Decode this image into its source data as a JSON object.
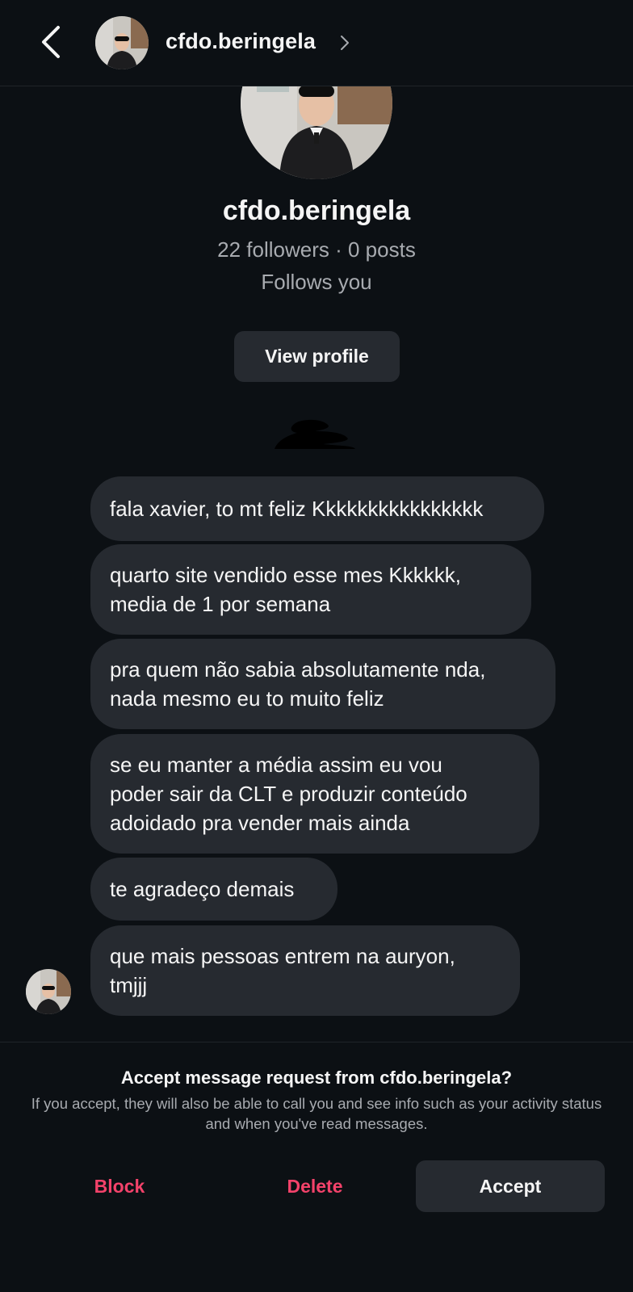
{
  "header": {
    "username": "cfdo.beringela"
  },
  "profile": {
    "username": "cfdo.beringela",
    "stats": "22 followers · 0 posts",
    "follows_status": "Follows you",
    "view_profile_label": "View profile"
  },
  "messages": [
    {
      "lines": [
        "fala xavier, to mt feliz Kkkkkkkkkkkkkkkk"
      ]
    },
    {
      "lines": [
        "quarto site vendido esse mes Kkkkkk,",
        "media de 1 por semana"
      ]
    },
    {
      "lines": [
        "pra quem não sabia absolutamente nda,",
        "nada mesmo eu to muito feliz"
      ]
    },
    {
      "lines": [
        "se eu manter a média assim eu vou",
        "poder sair da CLT e produzir conteúdo",
        "adoidado pra vender mais ainda"
      ]
    },
    {
      "lines": [
        "te agradeço demais"
      ]
    },
    {
      "lines": [
        "que mais pessoas entrem na auryon,",
        "tmjjj"
      ]
    }
  ],
  "request": {
    "title": "Accept message request from cfdo.beringela?",
    "description": "If you accept, they will also be able to call you and see info such as your activity status and when you've read messages.",
    "block_label": "Block",
    "delete_label": "Delete",
    "accept_label": "Accept"
  },
  "colors": {
    "background": "#0c1014",
    "bubble": "#262a30",
    "danger": "#f3426a",
    "secondary_text": "#a8abb0"
  }
}
